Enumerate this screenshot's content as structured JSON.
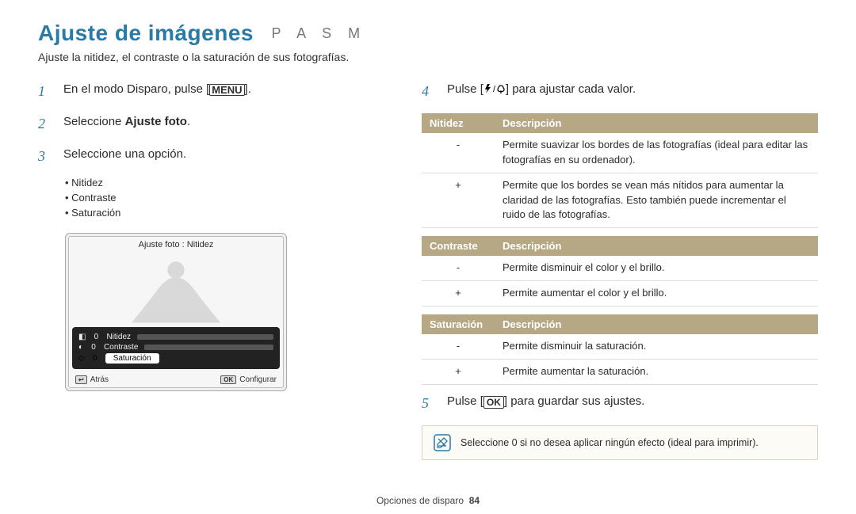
{
  "title": "Ajuste de imágenes",
  "modes": "P A S M",
  "subtitle": "Ajuste la nitidez, el contraste o la saturación de sus fotografías.",
  "left": {
    "step1_a": "En el modo Disparo, pulse [",
    "step1_menu": "MENU",
    "step1_b": "].",
    "step2_a": "Seleccione ",
    "step2_b": "Ajuste foto",
    "step2_c": ".",
    "step3": "Seleccione una opción.",
    "bullets": [
      "Nitidez",
      "Contraste",
      "Saturación"
    ],
    "camera": {
      "title": "Ajuste foto : Nitidez",
      "rows": [
        {
          "icon": "◧",
          "val": "0",
          "label": "Nitidez"
        },
        {
          "icon": "◐",
          "val": "0",
          "label": "Contraste"
        },
        {
          "icon": "◇",
          "val": "0",
          "label": "Saturación"
        }
      ],
      "back_key": "↩",
      "back": "Atrás",
      "ok_key": "OK",
      "ok": "Configurar"
    }
  },
  "right": {
    "step4_a": "Pulse [",
    "step4_b": "] para ajustar cada valor.",
    "tables": [
      {
        "h1": "Nitidez",
        "h2": "Descripción",
        "rows": [
          {
            "sym": "-",
            "desc": "Permite suavizar los bordes de las fotografías (ideal para editar las fotografías en su ordenador)."
          },
          {
            "sym": "+",
            "desc": "Permite que los bordes se vean más nítidos para aumentar la claridad de las fotografías. Esto también puede incrementar el ruido de las fotografías."
          }
        ]
      },
      {
        "h1": "Contraste",
        "h2": "Descripción",
        "rows": [
          {
            "sym": "-",
            "desc": "Permite disminuir el color y el brillo."
          },
          {
            "sym": "+",
            "desc": "Permite aumentar el color y el brillo."
          }
        ]
      },
      {
        "h1": "Saturación",
        "h2": "Descripción",
        "rows": [
          {
            "sym": "-",
            "desc": "Permite disminuir la saturación."
          },
          {
            "sym": "+",
            "desc": "Permite aumentar la saturación."
          }
        ]
      }
    ],
    "step5_a": "Pulse [",
    "step5_ok": "OK",
    "step5_b": "] para guardar sus ajustes.",
    "note": "Seleccione 0 si no desea aplicar ningún efecto (ideal para imprimir)."
  },
  "footer_a": "Opciones de disparo",
  "footer_b": "84"
}
